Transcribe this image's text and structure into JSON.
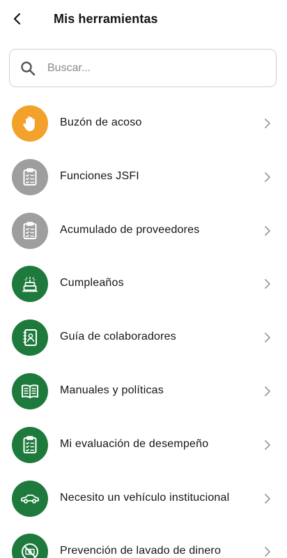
{
  "header": {
    "title": "Mis herramientas",
    "back_icon": "arrow-left-icon"
  },
  "search": {
    "placeholder": "Buscar...",
    "value": "",
    "icon": "search-icon"
  },
  "colors": {
    "orange": "#F2A22A",
    "gray": "#9E9E9E",
    "green": "#1E7A3C",
    "chevron": "#9a9a9a"
  },
  "items": [
    {
      "label": "Buzón de acoso",
      "icon": "hand-stop-icon",
      "color": "#F2A22A"
    },
    {
      "label": "Funciones JSFI",
      "icon": "clipboard-checklist-icon",
      "color": "#9E9E9E"
    },
    {
      "label": "Acumulado de proveedores",
      "icon": "clipboard-checklist-icon",
      "color": "#9E9E9E"
    },
    {
      "label": "Cumpleaños",
      "icon": "birthday-cake-icon",
      "color": "#1E7A3C"
    },
    {
      "label": "Guía de colaboradores",
      "icon": "contact-book-icon",
      "color": "#1E7A3C"
    },
    {
      "label": "Manuales y políticas",
      "icon": "open-book-icon",
      "color": "#1E7A3C"
    },
    {
      "label": "Mi evaluación de desempeño",
      "icon": "clipboard-checklist-icon",
      "color": "#1E7A3C"
    },
    {
      "label": "Necesito un vehículo institucional",
      "icon": "car-icon",
      "color": "#1E7A3C"
    },
    {
      "label": "Prevención de lavado de dinero",
      "icon": "no-money-icon",
      "color": "#1E7A3C"
    }
  ]
}
